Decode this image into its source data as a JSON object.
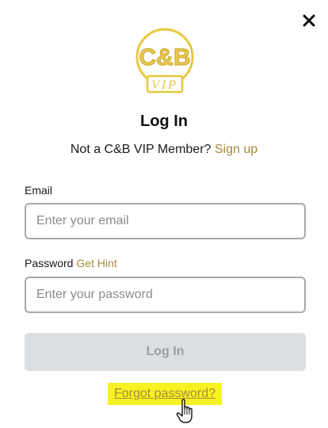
{
  "dialog": {
    "close_label": "close"
  },
  "logo": {
    "text_top": "C&B",
    "text_bottom": "VIP"
  },
  "header": {
    "title": "Log In",
    "prompt": "Not a C&B VIP Member?",
    "signup_link": "Sign up"
  },
  "form": {
    "email_label": "Email",
    "email_placeholder": "Enter your email",
    "email_value": "",
    "password_label": "Password",
    "hint_link": "Get Hint",
    "password_placeholder": "Enter your password",
    "password_value": "",
    "submit_label": "Log In",
    "forgot_link": "Forgot password?"
  },
  "colors": {
    "accent_gold": "#a58a3b",
    "logo_gold": "#e8c83a",
    "button_disabled_bg": "#dcdfe2",
    "highlight_yellow": "#f7f221"
  },
  "icons": {
    "close": "close-icon",
    "cursor": "hand-pointer-icon"
  }
}
